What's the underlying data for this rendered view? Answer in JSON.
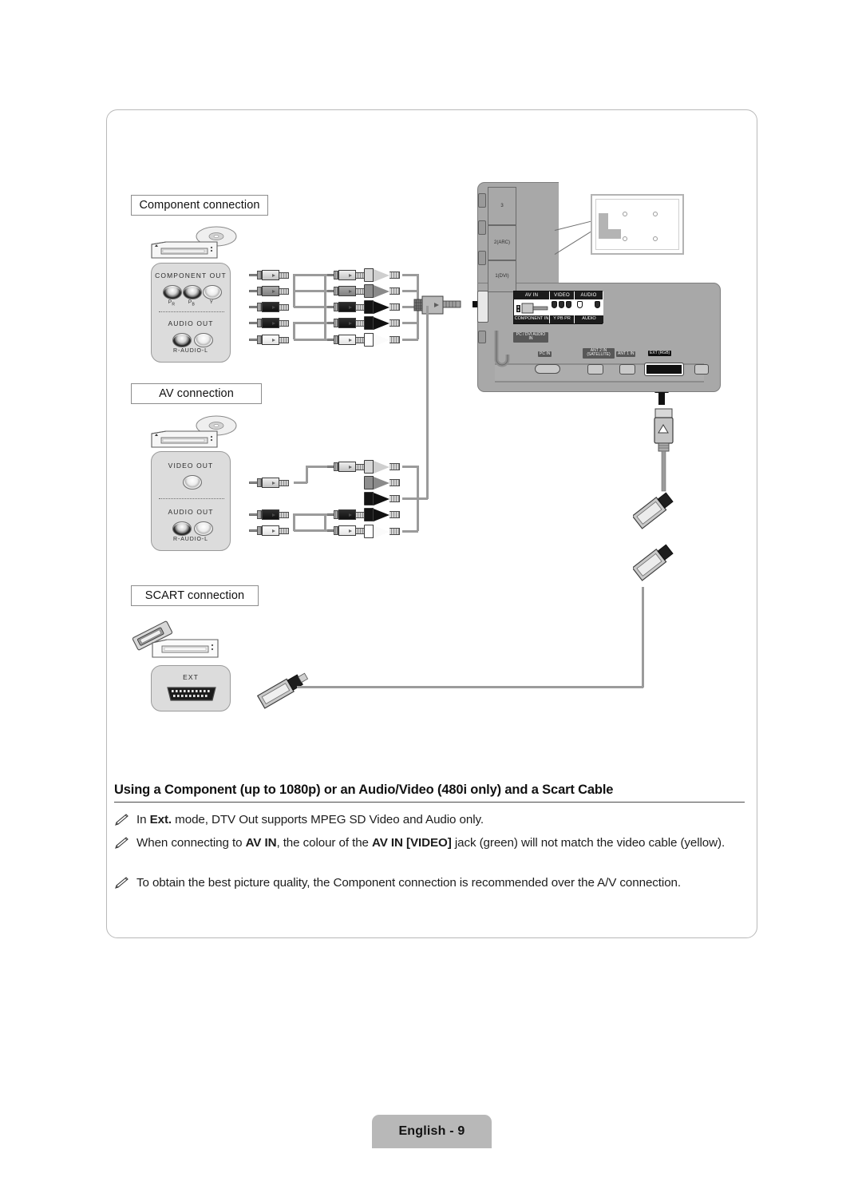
{
  "page": {
    "footer_label": "English - 9"
  },
  "sections": [
    {
      "id": "component",
      "caption": "Component connection"
    },
    {
      "id": "av",
      "caption": "AV connection"
    },
    {
      "id": "scart",
      "caption": "SCART connection"
    }
  ],
  "component_device": {
    "panel_title": "COMPONENT OUT",
    "jack_labels": [
      "PR",
      "PB",
      "Y"
    ],
    "audio_title": "AUDIO OUT",
    "audio_label": "R-AUDIO-L"
  },
  "av_device": {
    "panel_title": "VIDEO OUT",
    "audio_title": "AUDIO OUT",
    "audio_label": "R-AUDIO-L"
  },
  "scart_device": {
    "panel_title": "EXT"
  },
  "tv_panel": {
    "hdmi_labels": [
      "3",
      "2(ARC)",
      "1(DVI)"
    ],
    "avin": {
      "header_left": "AV IN",
      "header_video": "VIDEO",
      "header_audio": "AUDIO",
      "footer_left": "COMPONENT IN",
      "footer_video": "Y  PB  PR",
      "footer_audio": "AUDIO"
    },
    "side_tag": "PC / DVI AUDIO IN",
    "bottom_ports": [
      {
        "label": "PC IN",
        "inverted": false
      },
      {
        "label": "ANT 2 IN (SATELLITE)",
        "inverted": false
      },
      {
        "label": "ANT 1 IN",
        "inverted": false
      },
      {
        "label": "EXT (RGB)",
        "inverted": true
      },
      {
        "label": "",
        "inverted": false
      }
    ]
  },
  "body": {
    "headline": "Using a Component (up to 1080p) or an Audio/Video (480i only) and a Scart Cable",
    "notes": [
      {
        "parts": [
          {
            "text": "In ",
            "bold": false
          },
          {
            "text": "Ext.",
            "bold": true
          },
          {
            "text": " mode, DTV Out supports MPEG SD Video and Audio only.",
            "bold": false
          }
        ]
      },
      {
        "parts": [
          {
            "text": "When connecting to ",
            "bold": false
          },
          {
            "text": "AV IN",
            "bold": true
          },
          {
            "text": ", the colour of the ",
            "bold": false
          },
          {
            "text": "AV IN [VIDEO]",
            "bold": true
          },
          {
            "text": " jack (green) will not match the video cable (yellow).",
            "bold": false
          }
        ]
      },
      {
        "parts": [
          {
            "text": "To obtain the best picture quality, the Component connection is recommended over the A/V connection.",
            "bold": false
          }
        ]
      }
    ]
  },
  "colors": {
    "frame_border": "#b9b9b9",
    "panel_grey": "#a8a8a8",
    "jackcard_grey": "#dcdcdc",
    "wire_grey": "#9b9b9b",
    "footer_grey": "#b8b8b8"
  }
}
